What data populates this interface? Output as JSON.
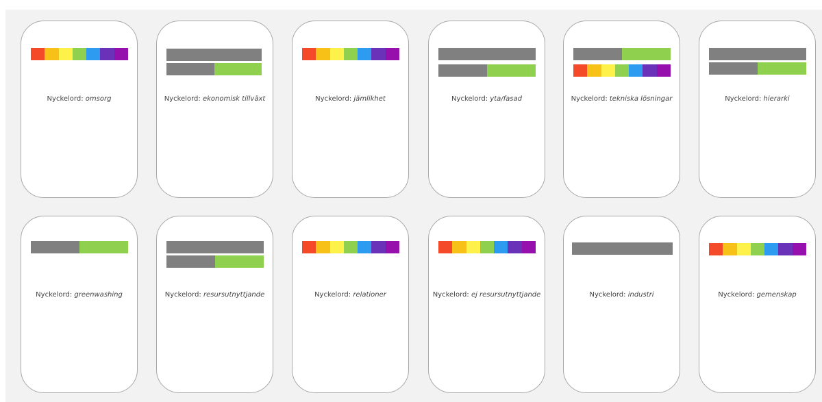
{
  "colors": {
    "red": "#f44a2a",
    "orange": "#f7c117",
    "yellow": "#fdf14a",
    "green": "#8fd14f",
    "blue": "#2d9bf0",
    "indigo": "#6a32b8",
    "violet": "#9510ac",
    "gray": "#808080",
    "board_background": "#f2f2f2",
    "card_border": "#a8a8a8"
  },
  "label_prefix": "Nyckelord:",
  "cards": [
    {
      "keyword": "omsorg",
      "pattern": [
        "rainbow"
      ]
    },
    {
      "keyword": "ekonomisk tillväxt",
      "pattern": [
        "gray",
        "split"
      ]
    },
    {
      "keyword": "jämlikhet",
      "pattern": [
        "rainbow"
      ]
    },
    {
      "keyword": "yta/fasad",
      "pattern": [
        "gray",
        "split"
      ]
    },
    {
      "keyword": "tekniska lösningar",
      "pattern": [
        "split",
        "rainbow"
      ]
    },
    {
      "keyword": "hierarki",
      "pattern": [
        "gray",
        "split"
      ]
    },
    {
      "keyword": "greenwashing",
      "pattern": [
        "split"
      ]
    },
    {
      "keyword": "resursutnyttjande",
      "pattern": [
        "gray",
        "split"
      ]
    },
    {
      "keyword": "relationer",
      "pattern": [
        "rainbow"
      ]
    },
    {
      "keyword": "ej resursutnyttjande",
      "pattern": [
        "rainbow"
      ]
    },
    {
      "keyword": "industri",
      "pattern": [
        "gray"
      ]
    },
    {
      "keyword": "gemenskap",
      "pattern": [
        "rainbow"
      ]
    }
  ]
}
